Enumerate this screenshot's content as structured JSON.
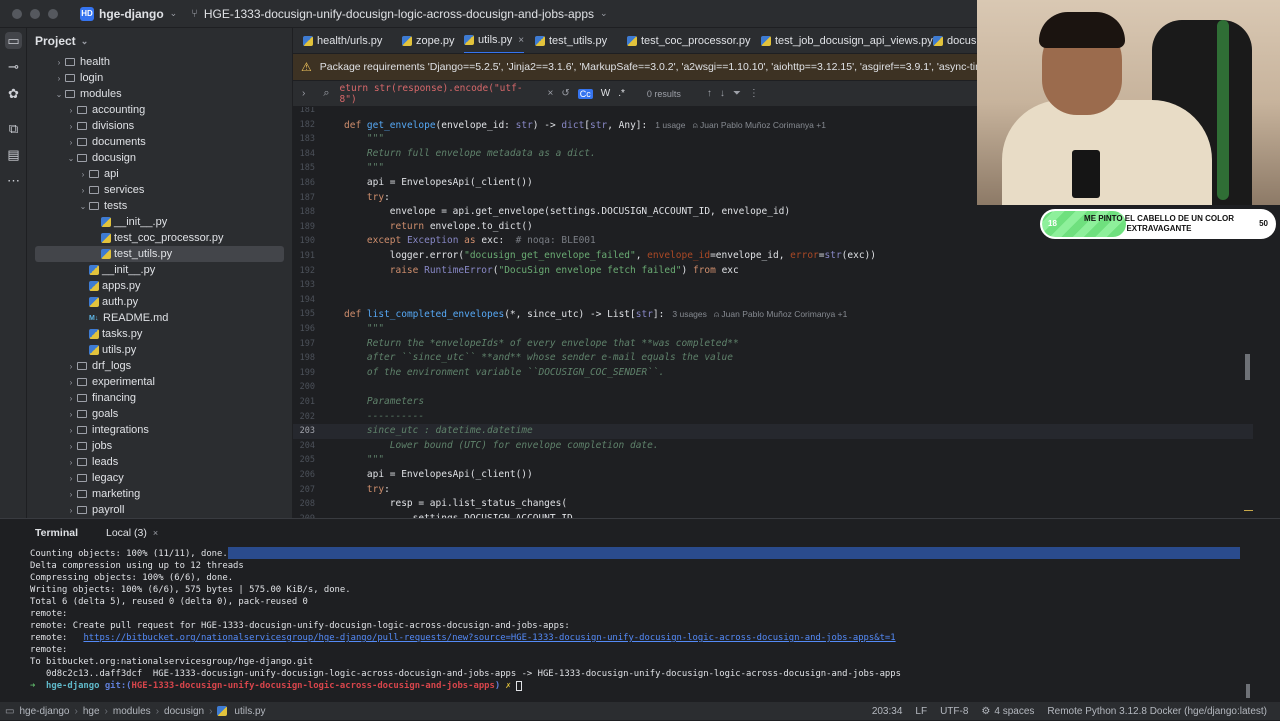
{
  "titlebar": {
    "project_badge": "HD",
    "project_name": "hge-django",
    "branch": "HGE-1333-docusign-unify-docusign-logic-across-docusign-and-jobs-apps"
  },
  "project_panel": {
    "title": "Project",
    "tree": [
      {
        "label": "health",
        "type": "folder",
        "level": 3,
        "expanded": false
      },
      {
        "label": "login",
        "type": "folder",
        "level": 3,
        "expanded": false
      },
      {
        "label": "modules",
        "type": "folder",
        "level": 3,
        "expanded": true
      },
      {
        "label": "accounting",
        "type": "folder",
        "level": 4,
        "expanded": false
      },
      {
        "label": "divisions",
        "type": "folder",
        "level": 4,
        "expanded": false
      },
      {
        "label": "documents",
        "type": "folder",
        "level": 4,
        "expanded": false
      },
      {
        "label": "docusign",
        "type": "folder",
        "level": 4,
        "expanded": true
      },
      {
        "label": "api",
        "type": "folder",
        "level": 5,
        "expanded": false
      },
      {
        "label": "services",
        "type": "folder",
        "level": 5,
        "expanded": false
      },
      {
        "label": "tests",
        "type": "folder",
        "level": 5,
        "expanded": true
      },
      {
        "label": "__init__.py",
        "type": "py",
        "level": 6
      },
      {
        "label": "test_coc_processor.py",
        "type": "py",
        "level": 6
      },
      {
        "label": "test_utils.py",
        "type": "py",
        "level": 6,
        "selected": true
      },
      {
        "label": "__init__.py",
        "type": "py",
        "level": 5
      },
      {
        "label": "apps.py",
        "type": "py",
        "level": 5
      },
      {
        "label": "auth.py",
        "type": "py",
        "level": 5
      },
      {
        "label": "README.md",
        "type": "md",
        "level": 5
      },
      {
        "label": "tasks.py",
        "type": "py",
        "level": 5
      },
      {
        "label": "utils.py",
        "type": "py",
        "level": 5
      },
      {
        "label": "drf_logs",
        "type": "folder",
        "level": 4,
        "expanded": false
      },
      {
        "label": "experimental",
        "type": "folder",
        "level": 4,
        "expanded": false
      },
      {
        "label": "financing",
        "type": "folder",
        "level": 4,
        "expanded": false
      },
      {
        "label": "goals",
        "type": "folder",
        "level": 4,
        "expanded": false
      },
      {
        "label": "integrations",
        "type": "folder",
        "level": 4,
        "expanded": false
      },
      {
        "label": "jobs",
        "type": "folder",
        "level": 4,
        "expanded": false
      },
      {
        "label": "leads",
        "type": "folder",
        "level": 4,
        "expanded": false
      },
      {
        "label": "legacy",
        "type": "folder",
        "level": 4,
        "expanded": false
      },
      {
        "label": "marketing",
        "type": "folder",
        "level": 4,
        "expanded": false
      },
      {
        "label": "payroll",
        "type": "folder",
        "level": 4,
        "expanded": false
      }
    ]
  },
  "editor_tabs": [
    {
      "label": "health/urls.py",
      "active": false
    },
    {
      "label": "zope.py",
      "active": false
    },
    {
      "label": "utils.py",
      "active": true
    },
    {
      "label": "test_utils.py",
      "active": false
    },
    {
      "label": "test_coc_processor.py",
      "active": false
    },
    {
      "label": "test_job_docusign_api_views.py",
      "active": false
    },
    {
      "label": "docusi",
      "active": false
    }
  ],
  "warning": {
    "text": "Package requirements 'Django==5.2.5', 'Jinja2==3.1.6', 'MarkupSafe==3.0.2', 'a2wsgi==1.10.10', 'aiohttp==3.12.15', 'asgiref==3.9.1', 'async-timeout==5.0.1', 'boto"
  },
  "find": {
    "query": "eturn str(response).encode(\"utf-8\")",
    "cc_label": "Cc",
    "w_label": "W",
    "regex_label": ".*",
    "results": "0 results"
  },
  "code": {
    "current_line": "203",
    "lines": [
      {
        "n": "181",
        "html": ""
      },
      {
        "n": "182",
        "html": "<span class='kw'>def</span> <span class='fn'>get_envelope</span>(envelope_id: <span class='bi'>str</span>) -&gt; <span class='bi'>dict</span>[<span class='bi'>str</span>, Any]:<span class='hint'>1 usage   ⍝ Juan Pablo Muñoz Corimanya +1</span>"
      },
      {
        "n": "183",
        "html": "    <span class='doc'>\"\"\"</span>"
      },
      {
        "n": "184",
        "html": "    <span class='doc'>Return full envelope metadata as a dict.</span>"
      },
      {
        "n": "185",
        "html": "    <span class='doc'>\"\"\"</span>"
      },
      {
        "n": "186",
        "html": "    api = EnvelopesApi(_client())"
      },
      {
        "n": "187",
        "html": "    <span class='kw'>try</span>:"
      },
      {
        "n": "188",
        "html": "        envelope = api.get_envelope(settings.DOCUSIGN_ACCOUNT_ID, envelope_id)"
      },
      {
        "n": "189",
        "html": "        <span class='kw'>return</span> envelope.to_dict()"
      },
      {
        "n": "190",
        "html": "    <span class='kw'>except</span> <span class='bi'>Exception</span> <span class='kw'>as</span> exc:  <span class='cm'># noqa: BLE001</span>"
      },
      {
        "n": "191",
        "html": "        logger.error(<span class='st'>\"docusign_get_envelope_failed\"</span>, <span class='prm'>envelope_id</span>=envelope_id, <span class='prm'>error</span>=<span class='bi'>str</span>(exc))"
      },
      {
        "n": "192",
        "html": "        <span class='kw'>raise</span> <span class='bi'>RuntimeError</span>(<span class='st'>\"DocuSign envelope fetch failed\"</span>) <span class='kw'>from</span> exc"
      },
      {
        "n": "193",
        "html": ""
      },
      {
        "n": "194",
        "html": ""
      },
      {
        "n": "195",
        "html": "<span class='kw'>def</span> <span class='fn'>list_completed_envelopes</span>(*, since_utc) -&gt; List[<span class='bi'>str</span>]:<span class='hint'>3 usages   ⍝ Juan Pablo Muñoz Corimanya +1</span>"
      },
      {
        "n": "196",
        "html": "    <span class='doc'>\"\"\"</span>"
      },
      {
        "n": "197",
        "html": "    <span class='doc'>Return the *envelopeIds* of every envelope that **was completed**</span>"
      },
      {
        "n": "198",
        "html": "    <span class='doc'>after ``since_utc`` **and** whose sender e-mail equals the value</span>"
      },
      {
        "n": "199",
        "html": "    <span class='doc'>of the environment variable ``DOCUSIGN_COC_SENDER``.</span>"
      },
      {
        "n": "200",
        "html": ""
      },
      {
        "n": "201",
        "html": "    <span class='doc'>Parameters</span>"
      },
      {
        "n": "202",
        "html": "    <span class='doc'>----------</span>"
      },
      {
        "n": "203",
        "html": "    <span class='doc'>since_utc : datetime.datetime</span>"
      },
      {
        "n": "204",
        "html": "        <span class='doc'>Lower bound (UTC) for envelope completion date.</span>"
      },
      {
        "n": "205",
        "html": "    <span class='doc'>\"\"\"</span>"
      },
      {
        "n": "206",
        "html": "    api = EnvelopesApi(_client())"
      },
      {
        "n": "207",
        "html": "    <span class='kw'>try</span>:"
      },
      {
        "n": "208",
        "html": "        resp = api.list_status_changes("
      },
      {
        "n": "209",
        "html": "            settings.DOCUSIGN_ACCOUNT_ID,"
      }
    ]
  },
  "overlay": {
    "goal_min": "18",
    "goal_max": "50",
    "goal_text": "ME PINTO EL CABELLO DE UN COLOR EXTRAVAGANTE",
    "goal_progress": 0.36
  },
  "terminal": {
    "tab_title": "Terminal",
    "tab_local": "Local (3)",
    "lines": [
      "Counting objects: 100% (11/11), done.",
      "Delta compression using up to 12 threads",
      "Compressing objects: 100% (6/6), done.",
      "Writing objects: 100% (6/6), 575 bytes | 575.00 KiB/s, done.",
      "Total 6 (delta 5), reused 0 (delta 0), pack-reused 0",
      "remote:",
      "remote: Create pull request for HGE-1333-docusign-unify-docusign-logic-across-docusign-and-jobs-apps:",
      "remote:   ",
      "remote:",
      "To bitbucket.org:nationalservicesgroup/hge-django.git",
      "   0d8c2c13..daff3dcf  HGE-1333-docusign-unify-docusign-logic-across-docusign-and-jobs-apps -> HGE-1333-docusign-unify-docusign-logic-across-docusign-and-jobs-apps"
    ],
    "link": "https://bitbucket.org/nationalservicesgroup/hge-django/pull-requests/new?source=HGE-1333-docusign-unify-docusign-logic-across-docusign-and-jobs-apps&t=1",
    "prompt_arrow": "➜",
    "prompt_dir": "hge-django",
    "prompt_git": "git:(",
    "prompt_branch": "HGE-1333-docusign-unify-docusign-logic-across-docusign-and-jobs-apps",
    "prompt_git_close": ")",
    "prompt_x": "✗"
  },
  "statusbar": {
    "breadcrumb": [
      "hge-django",
      "hge",
      "modules",
      "docusign",
      "utils.py"
    ],
    "position": "203:34",
    "line_ending": "LF",
    "encoding": "UTF-8",
    "indent": "4 spaces",
    "interpreter": "Remote Python 3.12.8 Docker (hge/django:latest)"
  }
}
